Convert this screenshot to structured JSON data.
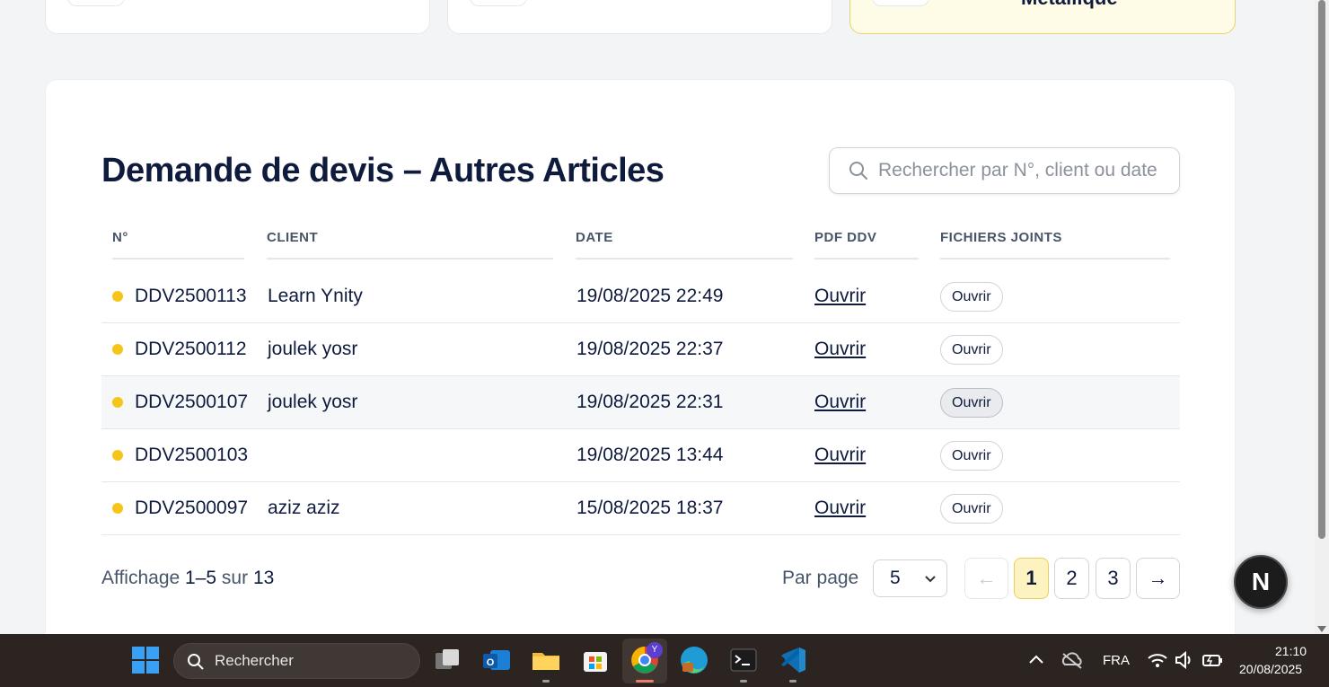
{
  "top_cards": [
    {
      "title": ""
    },
    {
      "title": ""
    },
    {
      "title": "Métallique"
    }
  ],
  "section": {
    "title": "Demande de devis – Autres Articles",
    "search_placeholder": "Rechercher par N°, client ou date"
  },
  "table": {
    "headers": {
      "num": "N°",
      "client": "CLIENT",
      "date": "DATE",
      "pdf": "PDF DDV",
      "files": "FICHIERS JOINTS"
    },
    "rows": [
      {
        "num": "DDV2500113",
        "client": "Learn Ynity",
        "date": "19/08/2025 22:49",
        "pdf": "Ouvrir",
        "files": "Ouvrir"
      },
      {
        "num": "DDV2500112",
        "client": "joulek yosr",
        "date": "19/08/2025 22:37",
        "pdf": "Ouvrir",
        "files": "Ouvrir"
      },
      {
        "num": "DDV2500107",
        "client": "joulek yosr",
        "date": "19/08/2025 22:31",
        "pdf": "Ouvrir",
        "files": "Ouvrir"
      },
      {
        "num": "DDV2500103",
        "client": "",
        "date": "19/08/2025 13:44",
        "pdf": "Ouvrir",
        "files": "Ouvrir"
      },
      {
        "num": "DDV2500097",
        "client": "aziz aziz",
        "date": "15/08/2025 18:37",
        "pdf": "Ouvrir",
        "files": "Ouvrir"
      }
    ],
    "status_color": "#f5c518"
  },
  "footer": {
    "prefix": "Affichage",
    "range": "1–5",
    "middle": "sur",
    "total": "13",
    "per_page_label": "Par page",
    "per_page_value": "5",
    "prev": "←",
    "pages": [
      "1",
      "2",
      "3"
    ],
    "next": "→"
  },
  "fab": {
    "letter": "N"
  },
  "taskbar": {
    "search_label": "Rechercher",
    "lang": "FRA",
    "time": "21:10",
    "date": "20/08/2025",
    "chrome_badge": "Y"
  }
}
